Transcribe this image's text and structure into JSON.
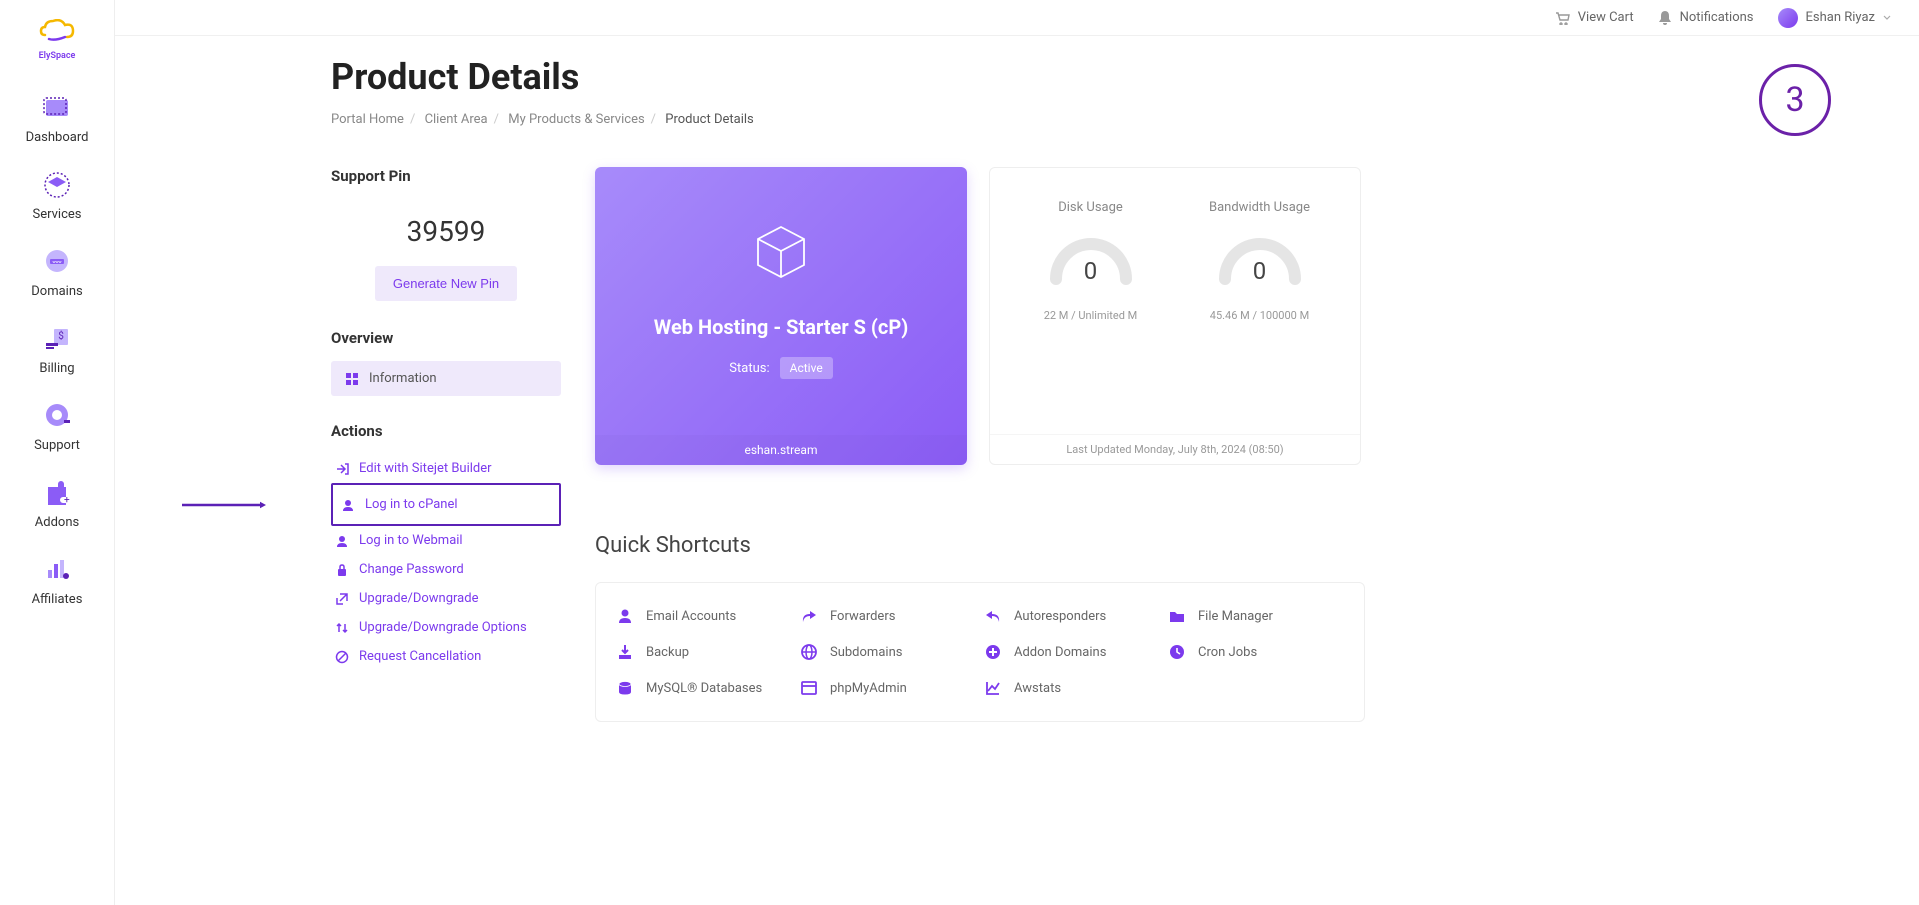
{
  "brand": {
    "name": "ElySpace"
  },
  "topbar": {
    "cart": "View Cart",
    "notifications": "Notifications",
    "user": "Eshan Riyaz"
  },
  "sidebar": {
    "items": [
      {
        "label": "Dashboard"
      },
      {
        "label": "Services"
      },
      {
        "label": "Domains"
      },
      {
        "label": "Billing"
      },
      {
        "label": "Support"
      },
      {
        "label": "Addons"
      },
      {
        "label": "Affiliates"
      }
    ]
  },
  "page": {
    "title": "Product Details",
    "breadcrumb": [
      "Portal Home",
      "Client Area",
      "My Products & Services",
      "Product Details"
    ],
    "badge": "3"
  },
  "support_pin": {
    "heading": "Support Pin",
    "value": "39599",
    "button": "Generate New Pin"
  },
  "overview": {
    "heading": "Overview",
    "item": "Information"
  },
  "actions": {
    "heading": "Actions",
    "items": [
      "Edit with Sitejet Builder",
      "Log in to cPanel",
      "Log in to Webmail",
      "Change Password",
      "Upgrade/Downgrade",
      "Upgrade/Downgrade Options",
      "Request Cancellation"
    ]
  },
  "hosting": {
    "title": "Web Hosting - Starter S (cP)",
    "status_label": "Status:",
    "status": "Active",
    "domain": "eshan.stream"
  },
  "usage": {
    "disk": {
      "label": "Disk Usage",
      "value": "0",
      "detail": "22 M / Unlimited M"
    },
    "bandwidth": {
      "label": "Bandwidth Usage",
      "value": "0",
      "detail": "45.46 M / 100000 M"
    },
    "updated": "Last Updated Monday, July 8th, 2024 (08:50)"
  },
  "shortcuts": {
    "heading": "Quick Shortcuts",
    "items": [
      "Email Accounts",
      "Forwarders",
      "Autoresponders",
      "File Manager",
      "Backup",
      "Subdomains",
      "Addon Domains",
      "Cron Jobs",
      "MySQL® Databases",
      "phpMyAdmin",
      "Awstats"
    ]
  },
  "colors": {
    "accent": "#7c3aed",
    "accentDark": "#5b21b6"
  }
}
